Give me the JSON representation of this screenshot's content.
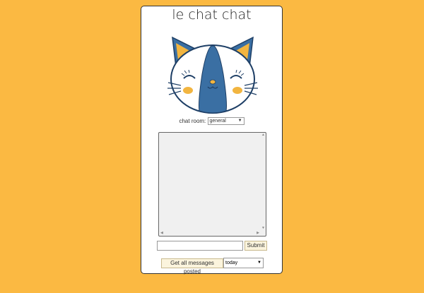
{
  "app": {
    "title": "le chat chat"
  },
  "room": {
    "label": "chat room:",
    "selected": "general"
  },
  "chat": {
    "messages_text": ""
  },
  "composer": {
    "input_value": "",
    "submit_label": "Submit"
  },
  "history": {
    "button_label": "Get all messages posted",
    "period_selected": "today"
  },
  "icons": {
    "logo": "cat-face-icon",
    "dropdown": "chevron-down-icon"
  },
  "colors": {
    "background": "#fbb942",
    "card": "#ffffff",
    "cat_blue": "#3a6fa3",
    "cat_orange": "#f2b540",
    "button_bg": "#fbf4dd"
  }
}
